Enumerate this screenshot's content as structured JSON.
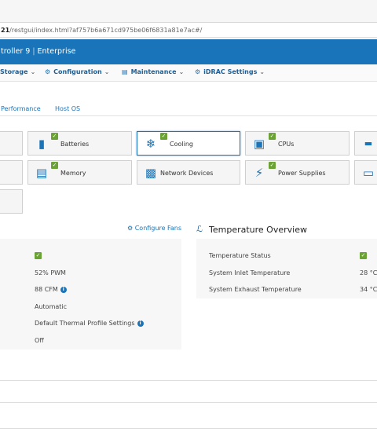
{
  "browser": {
    "url_host_fragment": "21",
    "url_path": "/restgui/index.html?af757b6a671cd975be06f6831a81e7ac#/"
  },
  "header": {
    "brand": "troller 9",
    "edition": "Enterprise",
    "brand_color": "#1a74b9"
  },
  "nav": {
    "items": [
      {
        "label": "Storage",
        "icon": "storage-icon"
      },
      {
        "label": "Configuration",
        "icon": "configuration-icon"
      },
      {
        "label": "Maintenance",
        "icon": "maintenance-icon"
      },
      {
        "label": "iDRAC Settings",
        "icon": "settings-icon"
      }
    ]
  },
  "subtabs": [
    {
      "label": "Performance"
    },
    {
      "label": "Host OS"
    }
  ],
  "tiles": [
    {
      "label": "Batteries",
      "icon": "battery-icon",
      "status": "ok"
    },
    {
      "label": "Cooling",
      "icon": "snowflake-icon",
      "status": "ok",
      "active": true
    },
    {
      "label": "CPUs",
      "icon": "cpu-icon",
      "status": "ok"
    },
    {
      "label": "Memory",
      "icon": "memory-icon",
      "status": "ok"
    },
    {
      "label": "Network Devices",
      "icon": "network-card-icon",
      "status": "none"
    },
    {
      "label": "Power Supplies",
      "icon": "power-plug-icon",
      "status": "ok"
    }
  ],
  "fans": {
    "configure_label": "Configure Fans",
    "values": [
      {
        "value": "",
        "status": "ok"
      },
      {
        "value": "52% PWM"
      },
      {
        "value": "88 CFM",
        "info": true
      },
      {
        "value": "Automatic"
      },
      {
        "value": "Default Thermal Profile Settings",
        "info": true
      },
      {
        "value": "Off"
      }
    ]
  },
  "temperature": {
    "title": "Temperature Overview",
    "rows": [
      {
        "label": "Temperature Status",
        "value": "",
        "status": "ok"
      },
      {
        "label": "System Inlet Temperature",
        "value": "28 °C"
      },
      {
        "label": "System Exhaust Temperature",
        "value": "34 °C"
      }
    ]
  },
  "colors": {
    "ok_green": "#6aa334",
    "link_blue": "#1a74b9"
  }
}
